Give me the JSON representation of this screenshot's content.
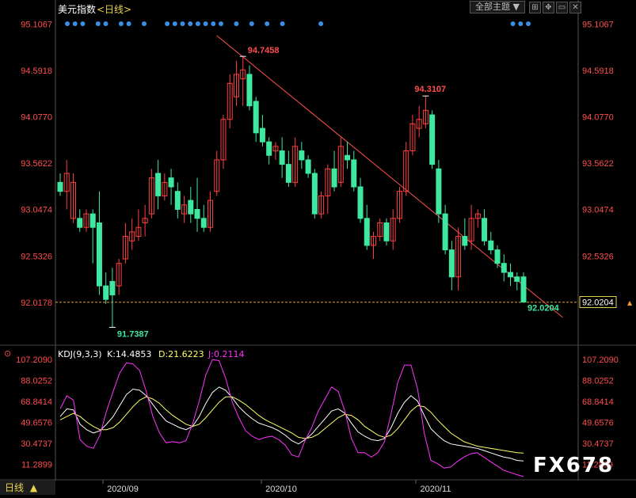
{
  "header": {
    "title": "美元指数",
    "period": "<日线>",
    "theme_button": "全部主题",
    "theme_arrow": "▼"
  },
  "indicator_header": {
    "name": "KDJ(9,3,3)",
    "k": "K:14.4853",
    "d": "D:21.6223",
    "j": "J:0.2114"
  },
  "bottom": {
    "period_label": "日线",
    "period_arrow": "▲"
  },
  "watermark": "FX678",
  "colors": {
    "up": "#ff3f3f",
    "down": "#3fe8a0",
    "price_axis": "#ff4d4d",
    "trendline": "#ff5050",
    "k": "#ffffff",
    "d": "#ffff66",
    "j": "#ff33ff",
    "dots": "#3a8ee6",
    "header": "#ffffff",
    "period": "#e8d44d"
  },
  "chart_data": [
    {
      "type": "candlestick",
      "title": "美元指数 <日线>",
      "ylim": [
        91.55,
        95.2
      ],
      "y_ticks": [
        "95.1067",
        "94.5918",
        "94.0770",
        "93.5622",
        "93.0474",
        "92.5326",
        "92.0178"
      ],
      "x_ticks": [
        "2020/09",
        "2020/10",
        "2020/11"
      ],
      "annotations": {
        "high": "94.7458",
        "high2": "94.3107",
        "low": "91.7387",
        "last": "92.0204",
        "last_tag": "92.0204",
        "ref_line": "92.0178"
      },
      "ohlc": [
        [
          93.35,
          93.45,
          93.2,
          93.25
        ],
        [
          93.25,
          93.6,
          93.05,
          93.45
        ],
        [
          92.95,
          93.45,
          92.9,
          93.35
        ],
        [
          92.95,
          93.05,
          92.8,
          92.85
        ],
        [
          92.85,
          93.05,
          92.8,
          93.0
        ],
        [
          93.0,
          93.05,
          92.45,
          92.85
        ],
        [
          92.9,
          93.25,
          92.1,
          92.2
        ],
        [
          92.2,
          92.35,
          92.0,
          92.05
        ],
        [
          92.25,
          92.4,
          91.74,
          92.1
        ],
        [
          92.2,
          92.5,
          92.1,
          92.45
        ],
        [
          92.5,
          92.9,
          92.45,
          92.75
        ],
        [
          92.7,
          92.95,
          92.6,
          92.8
        ],
        [
          92.75,
          93.05,
          92.7,
          92.85
        ],
        [
          92.9,
          93.1,
          92.75,
          92.95
        ],
        [
          93.0,
          93.5,
          92.95,
          93.4
        ],
        [
          93.45,
          93.6,
          93.05,
          93.2
        ],
        [
          93.2,
          93.45,
          93.15,
          93.35
        ],
        [
          93.4,
          93.5,
          93.1,
          93.3
        ],
        [
          93.25,
          93.35,
          92.95,
          93.05
        ],
        [
          93.0,
          93.2,
          92.9,
          93.1
        ],
        [
          93.15,
          93.3,
          92.9,
          93.0
        ],
        [
          93.05,
          93.4,
          92.8,
          92.95
        ],
        [
          92.95,
          93.1,
          92.8,
          92.85
        ],
        [
          92.85,
          93.25,
          92.8,
          93.15
        ],
        [
          93.25,
          93.7,
          93.2,
          93.6
        ],
        [
          93.6,
          94.1,
          93.5,
          94.05
        ],
        [
          94.05,
          94.55,
          93.95,
          94.45
        ],
        [
          94.3,
          94.7,
          94.2,
          94.55
        ],
        [
          94.5,
          94.75,
          94.2,
          94.6
        ],
        [
          94.55,
          94.65,
          94.15,
          94.2
        ],
        [
          94.25,
          94.3,
          93.8,
          93.9
        ],
        [
          93.95,
          94.1,
          93.75,
          93.8
        ],
        [
          93.8,
          93.85,
          93.55,
          93.65
        ],
        [
          93.7,
          93.8,
          93.6,
          93.75
        ],
        [
          93.7,
          93.85,
          93.4,
          93.55
        ],
        [
          93.55,
          93.7,
          93.3,
          93.35
        ],
        [
          93.35,
          93.85,
          93.3,
          93.75
        ],
        [
          93.7,
          93.8,
          93.5,
          93.6
        ],
        [
          93.6,
          93.65,
          93.4,
          93.45
        ],
        [
          93.45,
          93.5,
          92.95,
          93.0
        ],
        [
          93.0,
          93.25,
          92.95,
          93.2
        ],
        [
          93.2,
          93.55,
          93.0,
          93.5
        ],
        [
          93.5,
          93.7,
          93.25,
          93.3
        ],
        [
          93.35,
          93.85,
          93.3,
          93.75
        ],
        [
          93.65,
          93.8,
          93.5,
          93.6
        ],
        [
          93.6,
          93.7,
          93.25,
          93.3
        ],
        [
          93.3,
          93.4,
          92.9,
          92.95
        ],
        [
          92.95,
          93.1,
          92.6,
          92.65
        ],
        [
          92.65,
          92.8,
          92.5,
          92.75
        ],
        [
          92.75,
          92.95,
          92.7,
          92.9
        ],
        [
          92.9,
          92.95,
          92.65,
          92.7
        ],
        [
          92.7,
          93.05,
          92.6,
          92.95
        ],
        [
          92.95,
          93.3,
          92.9,
          93.25
        ],
        [
          93.25,
          93.8,
          93.2,
          93.7
        ],
        [
          93.7,
          94.1,
          93.65,
          94.0
        ],
        [
          93.95,
          94.2,
          93.85,
          94.05
        ],
        [
          94.0,
          94.31,
          93.95,
          94.15
        ],
        [
          94.1,
          94.15,
          93.5,
          93.55
        ],
        [
          93.5,
          93.6,
          92.9,
          93.0
        ],
        [
          93.0,
          93.1,
          92.55,
          92.6
        ],
        [
          92.6,
          92.7,
          92.15,
          92.3
        ],
        [
          92.3,
          92.85,
          92.15,
          92.75
        ],
        [
          92.75,
          92.95,
          92.6,
          92.65
        ],
        [
          92.7,
          93.1,
          92.6,
          92.95
        ],
        [
          92.95,
          93.05,
          92.85,
          93.0
        ],
        [
          92.95,
          93.05,
          92.65,
          92.7
        ],
        [
          92.7,
          92.8,
          92.55,
          92.6
        ],
        [
          92.6,
          92.65,
          92.4,
          92.45
        ],
        [
          92.45,
          92.55,
          92.25,
          92.35
        ],
        [
          92.35,
          92.45,
          92.2,
          92.3
        ],
        [
          92.3,
          92.35,
          92.15,
          92.25
        ],
        [
          92.3,
          92.35,
          92.02,
          92.02
        ]
      ]
    },
    {
      "type": "line",
      "title": "KDJ(9,3,3)",
      "ylim": [
        -2,
        110
      ],
      "y_ticks": [
        "107.2090",
        "88.0252",
        "68.8414",
        "49.6576",
        "30.4737",
        "11.2899"
      ],
      "series": [
        {
          "name": "K",
          "values": [
            55,
            62,
            61,
            48,
            43,
            40,
            42,
            48,
            55,
            65,
            75,
            80,
            79,
            74,
            66,
            58,
            51,
            48,
            45,
            43,
            46,
            55,
            67,
            77,
            82,
            79,
            72,
            64,
            58,
            53,
            49,
            47,
            45,
            42,
            38,
            33,
            30,
            34,
            39,
            46,
            53,
            60,
            62,
            58,
            49,
            41,
            37,
            34,
            33,
            35,
            45,
            58,
            68,
            74,
            69,
            56,
            44,
            38,
            33,
            30,
            29,
            28,
            27,
            26,
            24,
            22,
            20,
            18,
            17,
            15,
            14.4853
          ]
        },
        {
          "name": "D",
          "values": [
            52,
            55,
            58,
            55,
            50,
            46,
            43,
            43,
            45,
            50,
            57,
            64,
            70,
            73,
            71,
            67,
            61,
            56,
            52,
            48,
            46,
            48,
            54,
            61,
            68,
            73,
            73,
            70,
            66,
            61,
            56,
            52,
            49,
            46,
            43,
            40,
            36,
            35,
            36,
            39,
            44,
            49,
            54,
            57,
            56,
            52,
            46,
            42,
            38,
            36,
            38,
            44,
            52,
            60,
            65,
            64,
            59,
            52,
            46,
            40,
            36,
            32,
            30,
            28,
            27,
            26,
            25,
            24,
            23,
            22,
            21.6223
          ]
        },
        {
          "name": "J",
          "values": [
            62,
            74,
            70,
            34,
            28,
            26,
            38,
            60,
            78,
            95,
            104,
            103,
            97,
            78,
            55,
            40,
            31,
            32,
            31,
            33,
            48,
            69,
            93,
            107,
            106,
            90,
            68,
            54,
            42,
            37,
            34,
            36,
            37,
            34,
            29,
            20,
            18,
            33,
            45,
            60,
            71,
            82,
            78,
            60,
            35,
            22,
            22,
            18,
            22,
            32,
            58,
            86,
            102,
            102,
            80,
            40,
            15,
            12,
            8,
            9,
            14,
            18,
            21,
            22,
            18,
            14,
            10,
            6,
            4,
            2,
            0.2114
          ]
        }
      ]
    }
  ]
}
